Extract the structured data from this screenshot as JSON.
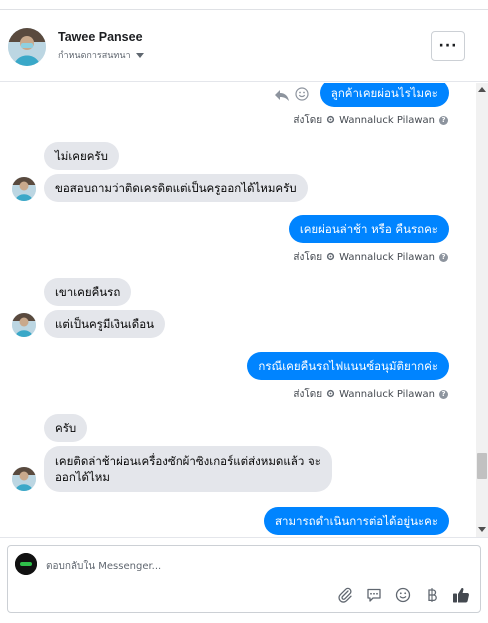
{
  "header": {
    "name": "Tawee Pansee",
    "subtitle": "กำหนดการสนทนา",
    "more_label": "···"
  },
  "messages": [
    {
      "dir": "out",
      "text": "ลูกค้าเคยผ่อนไรไมคะ"
    },
    {
      "dir": "meta",
      "text": "ส่งโดย",
      "sender": "Wannaluck Pilawan"
    },
    {
      "dir": "in",
      "text": "ไม่เคยครับ"
    },
    {
      "dir": "in",
      "text": "ขอสอบถามว่าติดเครดิตแต่เป็นครูออกได้ไหมครับ"
    },
    {
      "dir": "out",
      "text": "เคยผ่อนล่าช้า หรือ คืนรถคะ"
    },
    {
      "dir": "meta",
      "text": "ส่งโดย",
      "sender": "Wannaluck Pilawan"
    },
    {
      "dir": "in",
      "text": "เขาเคยคืนรถ"
    },
    {
      "dir": "in",
      "text": "แต่เป็นครูมีเงินเดือน"
    },
    {
      "dir": "out",
      "text": "กรณีเคยคืนรถไฟแนนซ์อนุมัติยากค่ะ"
    },
    {
      "dir": "meta",
      "text": "ส่งโดย",
      "sender": "Wannaluck Pilawan"
    },
    {
      "dir": "in",
      "text": "ครับ"
    },
    {
      "dir": "in",
      "text": "เคยติดล่าช้าผ่อนเครื่องซักผ้าซิงเกอร์แต่ส่งหมดแล้ว จะออกได้ไหม"
    },
    {
      "dir": "out",
      "text": "สามารถดำเนินการต่อได้อยู่นะคะ"
    }
  ],
  "composer": {
    "placeholder": "ตอบกลับใน Messenger..."
  },
  "icons": {
    "attach": "paperclip-icon",
    "saved_replies": "chat-bubble-icon",
    "emoji": "smiley-icon",
    "payment": "baht-icon",
    "like": "thumbs-up-icon"
  },
  "colors": {
    "outgoing_bubble": "#0084ff",
    "incoming_bubble": "#e4e6eb"
  }
}
